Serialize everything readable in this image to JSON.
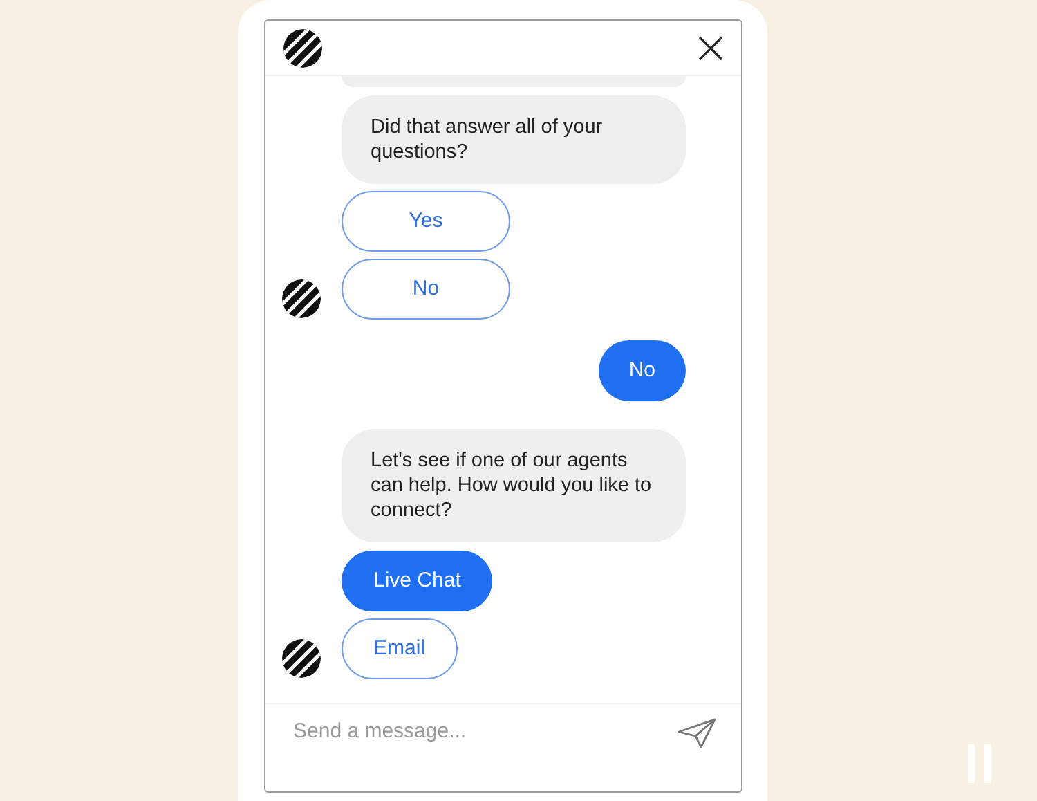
{
  "chat": {
    "messages": [
      {
        "kind": "bot_text",
        "text": "Did that answer all of your questions?"
      },
      {
        "kind": "quick_replies",
        "avatar": true,
        "options": [
          {
            "label": "Yes",
            "selected": false
          },
          {
            "label": "No",
            "selected": false
          }
        ]
      },
      {
        "kind": "user_text",
        "text": "No"
      },
      {
        "kind": "bot_text",
        "text": "Let's see if one of our agents can help. How would you like to connect?"
      },
      {
        "kind": "quick_replies",
        "avatar": true,
        "options": [
          {
            "label": "Live Chat",
            "selected": true
          },
          {
            "label": "Email",
            "selected": false
          }
        ]
      }
    ],
    "composer": {
      "placeholder": "Send a message..."
    }
  }
}
